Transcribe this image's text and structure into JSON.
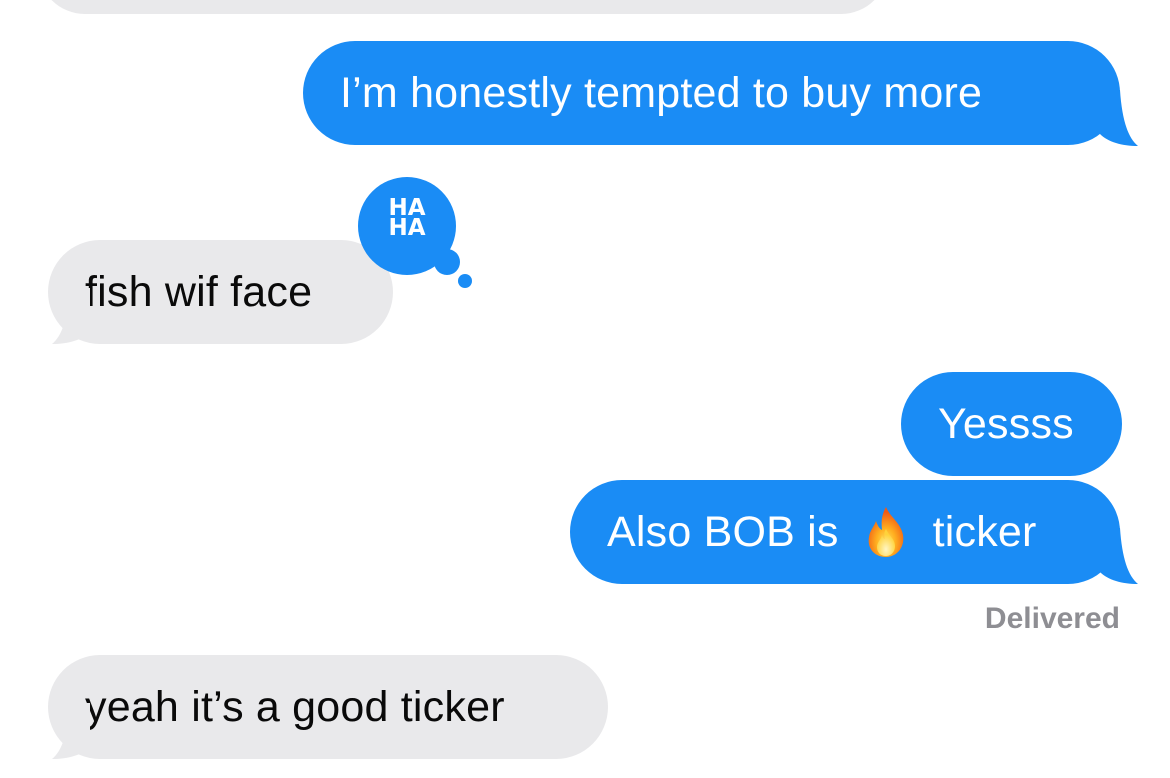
{
  "conversation": {
    "messages": [
      {
        "direction": "sent",
        "text": "I’m honestly tempted to buy more"
      },
      {
        "direction": "received",
        "text": "fish wif face",
        "reaction": "HA HA"
      },
      {
        "direction": "sent",
        "text": "Yessss"
      },
      {
        "direction": "sent",
        "text_before_emoji": "Also BOB is",
        "emoji": "fire-emoji",
        "text_after_emoji": "ticker"
      },
      {
        "direction": "received",
        "text": "yeah it’s a good ticker"
      }
    ],
    "reaction": {
      "line1": "HA",
      "line2": "HA"
    },
    "status": "Delivered"
  },
  "colors": {
    "sent_bubble": "#1a8cf5",
    "received_bubble": "#e9e9eb",
    "status_text": "#8e8e93"
  }
}
